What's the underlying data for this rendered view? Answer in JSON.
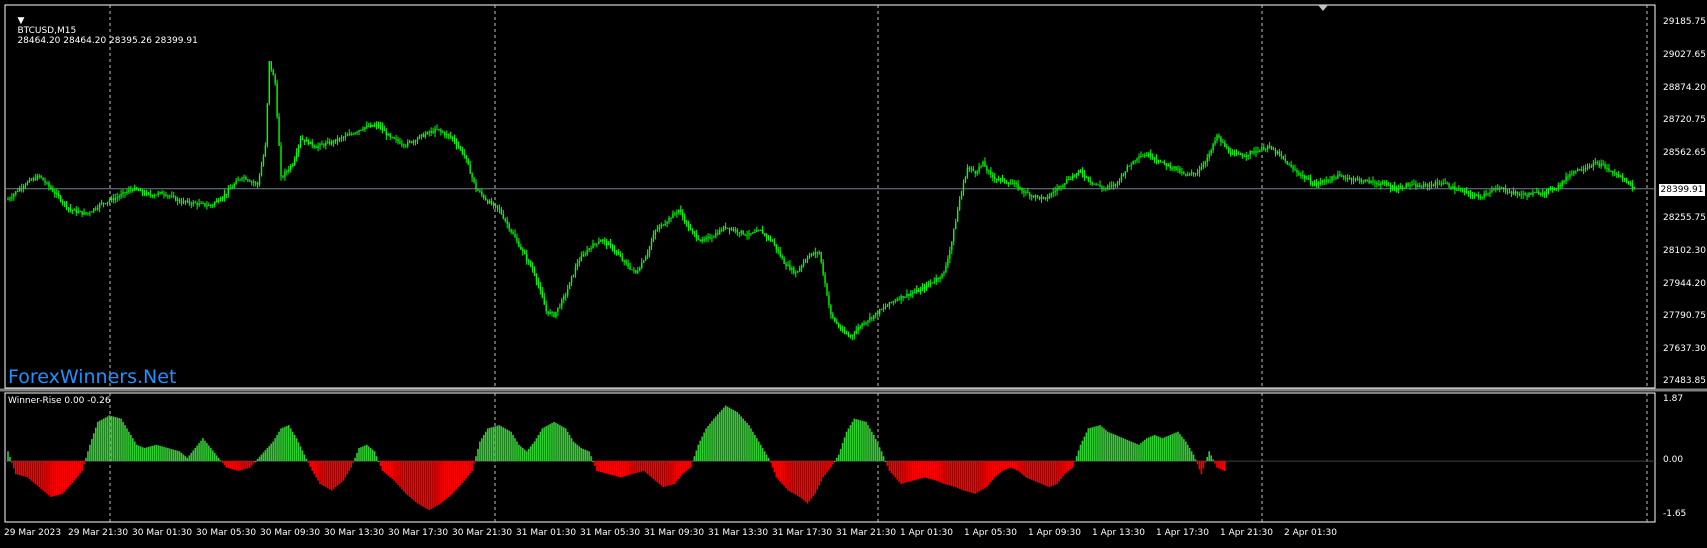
{
  "chart_header": {
    "collapse_icon": "triangle-down-icon",
    "symbol_timeframe": "BTCUSD,M15",
    "ohlc": "28464.20 28464.20 28395.26 28399.91"
  },
  "indicator_header": "Winner-Rise 0.00 -0.26",
  "watermark": "ForexWinners.Net",
  "current_price_label": "28399.91",
  "price_ticks": [
    "29185.75",
    "29027.65",
    "28874.20",
    "28720.75",
    "28562.65",
    "28255.75",
    "28102.30",
    "27944.20",
    "27790.75",
    "27637.30",
    "27483.85"
  ],
  "indicator_ticks": [
    "1.87",
    "0.00",
    "-1.65"
  ],
  "time_ticks": [
    "29 Mar 2023",
    "29 Mar 21:30",
    "30 Mar 01:30",
    "30 Mar 05:30",
    "30 Mar 09:30",
    "30 Mar 13:30",
    "30 Mar 17:30",
    "30 Mar 21:30",
    "31 Mar 01:30",
    "31 Mar 05:30",
    "31 Mar 09:30",
    "31 Mar 13:30",
    "31 Mar 17:30",
    "31 Mar 21:30",
    "1 Apr 01:30",
    "1 Apr 05:30",
    "1 Apr 09:30",
    "1 Apr 13:30",
    "1 Apr 17:30",
    "1 Apr 21:30",
    "2 Apr 01:30"
  ],
  "colors": {
    "background": "#000000",
    "candle": "#00ff00",
    "hist_up": "#32cd32",
    "hist_down": "#ff0000",
    "grid": "#c0c0c0",
    "price_line": "#708090",
    "watermark": "#1e90ff"
  },
  "chart_data": [
    {
      "type": "candlestick",
      "title": "BTCUSD,M15",
      "ylim": [
        27483.85,
        29185.75
      ],
      "x_tick_labels": [
        "29 Mar 2023",
        "29 Mar 21:30",
        "30 Mar 01:30",
        "30 Mar 05:30",
        "30 Mar 09:30",
        "30 Mar 13:30",
        "30 Mar 17:30",
        "30 Mar 21:30",
        "31 Mar 01:30",
        "31 Mar 05:30",
        "31 Mar 09:30",
        "31 Mar 13:30",
        "31 Mar 17:30",
        "31 Mar 21:30",
        "1 Apr 01:30",
        "1 Apr 05:30",
        "1 Apr 09:30",
        "1 Apr 13:30",
        "1 Apr 17:30",
        "1 Apr 21:30",
        "2 Apr 01:30"
      ],
      "close_path": [
        [
          0,
          28350
        ],
        [
          8,
          28420
        ],
        [
          16,
          28460
        ],
        [
          24,
          28380
        ],
        [
          32,
          28300
        ],
        [
          40,
          28280
        ],
        [
          48,
          28330
        ],
        [
          56,
          28360
        ],
        [
          64,
          28400
        ],
        [
          72,
          28370
        ],
        [
          80,
          28380
        ],
        [
          88,
          28340
        ],
        [
          96,
          28330
        ],
        [
          104,
          28320
        ],
        [
          112,
          28380
        ],
        [
          120,
          28460
        ],
        [
          128,
          28420
        ],
        [
          132,
          28600
        ],
        [
          134,
          29000
        ],
        [
          137,
          28900
        ],
        [
          140,
          28450
        ],
        [
          146,
          28520
        ],
        [
          150,
          28640
        ],
        [
          158,
          28600
        ],
        [
          166,
          28620
        ],
        [
          174,
          28650
        ],
        [
          182,
          28690
        ],
        [
          190,
          28700
        ],
        [
          196,
          28640
        ],
        [
          204,
          28610
        ],
        [
          212,
          28650
        ],
        [
          220,
          28680
        ],
        [
          228,
          28640
        ],
        [
          234,
          28560
        ],
        [
          240,
          28400
        ],
        [
          246,
          28340
        ],
        [
          252,
          28300
        ],
        [
          258,
          28200
        ],
        [
          264,
          28100
        ],
        [
          270,
          28000
        ],
        [
          276,
          27820
        ],
        [
          280,
          27800
        ],
        [
          286,
          27900
        ],
        [
          292,
          28050
        ],
        [
          298,
          28120
        ],
        [
          304,
          28160
        ],
        [
          310,
          28120
        ],
        [
          316,
          28050
        ],
        [
          322,
          28000
        ],
        [
          328,
          28100
        ],
        [
          332,
          28200
        ],
        [
          338,
          28250
        ],
        [
          344,
          28300
        ],
        [
          350,
          28200
        ],
        [
          356,
          28150
        ],
        [
          362,
          28180
        ],
        [
          368,
          28220
        ],
        [
          374,
          28200
        ],
        [
          380,
          28180
        ],
        [
          386,
          28200
        ],
        [
          392,
          28150
        ],
        [
          398,
          28050
        ],
        [
          404,
          28000
        ],
        [
          410,
          28080
        ],
        [
          416,
          28100
        ],
        [
          422,
          27800
        ],
        [
          428,
          27720
        ],
        [
          432,
          27700
        ],
        [
          438,
          27760
        ],
        [
          444,
          27800
        ],
        [
          450,
          27840
        ],
        [
          456,
          27880
        ],
        [
          462,
          27900
        ],
        [
          468,
          27920
        ],
        [
          474,
          27960
        ],
        [
          480,
          28000
        ],
        [
          484,
          28150
        ],
        [
          488,
          28350
        ],
        [
          492,
          28500
        ],
        [
          496,
          28480
        ],
        [
          500,
          28520
        ],
        [
          504,
          28460
        ],
        [
          510,
          28440
        ],
        [
          516,
          28420
        ],
        [
          522,
          28380
        ],
        [
          528,
          28360
        ],
        [
          532,
          28350
        ],
        [
          538,
          28400
        ],
        [
          544,
          28450
        ],
        [
          550,
          28480
        ],
        [
          556,
          28430
        ],
        [
          562,
          28400
        ],
        [
          568,
          28420
        ],
        [
          574,
          28500
        ],
        [
          580,
          28560
        ],
        [
          586,
          28560
        ],
        [
          592,
          28520
        ],
        [
          598,
          28500
        ],
        [
          604,
          28460
        ],
        [
          610,
          28480
        ],
        [
          616,
          28560
        ],
        [
          620,
          28650
        ],
        [
          624,
          28600
        ],
        [
          628,
          28560
        ],
        [
          634,
          28560
        ],
        [
          640,
          28580
        ],
        [
          646,
          28600
        ],
        [
          652,
          28560
        ],
        [
          658,
          28500
        ],
        [
          664,
          28460
        ],
        [
          670,
          28420
        ],
        [
          676,
          28440
        ],
        [
          682,
          28460
        ],
        [
          688,
          28450
        ],
        [
          694,
          28440
        ],
        [
          700,
          28430
        ],
        [
          706,
          28420
        ],
        [
          712,
          28400
        ],
        [
          718,
          28420
        ],
        [
          724,
          28410
        ],
        [
          730,
          28420
        ],
        [
          736,
          28430
        ],
        [
          742,
          28400
        ],
        [
          748,
          28380
        ],
        [
          754,
          28360
        ],
        [
          760,
          28390
        ],
        [
          766,
          28400
        ],
        [
          772,
          28380
        ],
        [
          778,
          28370
        ],
        [
          784,
          28380
        ],
        [
          790,
          28390
        ],
        [
          796,
          28420
        ],
        [
          802,
          28480
        ],
        [
          808,
          28500
        ],
        [
          814,
          28520
        ],
        [
          818,
          28510
        ],
        [
          822,
          28480
        ],
        [
          826,
          28460
        ],
        [
          830,
          28440
        ],
        [
          834,
          28400
        ]
      ]
    },
    {
      "type": "bar",
      "title": "Winner-Rise",
      "ylim": [
        -1.65,
        1.87
      ],
      "x_range_bars": [
        0,
        835
      ],
      "bars": [
        [
          0,
          0.3
        ],
        [
          4,
          -0.4
        ],
        [
          10,
          -0.5
        ],
        [
          16,
          -0.8
        ],
        [
          22,
          -1.1
        ],
        [
          28,
          -1.0
        ],
        [
          34,
          -0.6
        ],
        [
          38,
          -0.3
        ],
        [
          42,
          0.5
        ],
        [
          46,
          1.2
        ],
        [
          52,
          1.4
        ],
        [
          58,
          1.3
        ],
        [
          62,
          0.9
        ],
        [
          66,
          0.5
        ],
        [
          70,
          0.4
        ],
        [
          76,
          0.5
        ],
        [
          82,
          0.4
        ],
        [
          88,
          0.3
        ],
        [
          92,
          0.1
        ],
        [
          96,
          0.4
        ],
        [
          100,
          0.7
        ],
        [
          104,
          0.4
        ],
        [
          108,
          0.1
        ],
        [
          112,
          -0.2
        ],
        [
          118,
          -0.3
        ],
        [
          124,
          -0.2
        ],
        [
          130,
          0.2
        ],
        [
          136,
          0.6
        ],
        [
          140,
          1.0
        ],
        [
          144,
          1.1
        ],
        [
          148,
          0.7
        ],
        [
          152,
          0.2
        ],
        [
          156,
          -0.3
        ],
        [
          160,
          -0.7
        ],
        [
          166,
          -0.9
        ],
        [
          172,
          -0.6
        ],
        [
          176,
          -0.2
        ],
        [
          180,
          0.4
        ],
        [
          184,
          0.5
        ],
        [
          188,
          0.3
        ],
        [
          192,
          -0.3
        ],
        [
          198,
          -0.6
        ],
        [
          204,
          -1.0
        ],
        [
          210,
          -1.3
        ],
        [
          216,
          -1.5
        ],
        [
          222,
          -1.3
        ],
        [
          228,
          -1.0
        ],
        [
          234,
          -0.6
        ],
        [
          238,
          -0.3
        ],
        [
          242,
          0.6
        ],
        [
          246,
          1.0
        ],
        [
          252,
          1.1
        ],
        [
          258,
          0.9
        ],
        [
          262,
          0.5
        ],
        [
          266,
          0.3
        ],
        [
          270,
          0.6
        ],
        [
          274,
          1.0
        ],
        [
          280,
          1.2
        ],
        [
          286,
          1.0
        ],
        [
          290,
          0.6
        ],
        [
          294,
          0.4
        ],
        [
          298,
          0.3
        ],
        [
          302,
          -0.3
        ],
        [
          308,
          -0.4
        ],
        [
          314,
          -0.5
        ],
        [
          320,
          -0.4
        ],
        [
          326,
          -0.3
        ],
        [
          330,
          -0.5
        ],
        [
          336,
          -0.8
        ],
        [
          342,
          -0.7
        ],
        [
          346,
          -0.4
        ],
        [
          350,
          -0.2
        ],
        [
          354,
          0.5
        ],
        [
          358,
          1.0
        ],
        [
          362,
          1.3
        ],
        [
          368,
          1.7
        ],
        [
          374,
          1.5
        ],
        [
          380,
          1.1
        ],
        [
          386,
          0.5
        ],
        [
          390,
          0.1
        ],
        [
          394,
          -0.5
        ],
        [
          400,
          -0.9
        ],
        [
          406,
          -1.1
        ],
        [
          410,
          -1.3
        ],
        [
          414,
          -1.0
        ],
        [
          418,
          -0.5
        ],
        [
          422,
          -0.2
        ],
        [
          426,
          0.2
        ],
        [
          430,
          0.9
        ],
        [
          434,
          1.3
        ],
        [
          440,
          1.2
        ],
        [
          444,
          0.8
        ],
        [
          448,
          0.3
        ],
        [
          452,
          -0.3
        ],
        [
          458,
          -0.7
        ],
        [
          464,
          -0.6
        ],
        [
          470,
          -0.5
        ],
        [
          476,
          -0.6
        ],
        [
          480,
          -0.7
        ],
        [
          486,
          -0.8
        ],
        [
          490,
          -0.9
        ],
        [
          496,
          -1.0
        ],
        [
          502,
          -0.8
        ],
        [
          506,
          -0.5
        ],
        [
          510,
          -0.3
        ],
        [
          514,
          -0.2
        ],
        [
          518,
          -0.3
        ],
        [
          522,
          -0.5
        ],
        [
          526,
          -0.6
        ],
        [
          530,
          -0.7
        ],
        [
          534,
          -0.8
        ],
        [
          538,
          -0.7
        ],
        [
          542,
          -0.4
        ],
        [
          546,
          -0.2
        ],
        [
          550,
          0.5
        ],
        [
          554,
          1.0
        ],
        [
          560,
          1.1
        ],
        [
          564,
          0.9
        ],
        [
          568,
          0.8
        ],
        [
          572,
          0.7
        ],
        [
          576,
          0.6
        ],
        [
          580,
          0.5
        ],
        [
          584,
          0.7
        ],
        [
          588,
          0.8
        ],
        [
          592,
          0.7
        ],
        [
          596,
          0.8
        ],
        [
          600,
          0.9
        ],
        [
          604,
          0.6
        ],
        [
          608,
          0.2
        ],
        [
          612,
          -0.4
        ],
        [
          616,
          0.3
        ],
        [
          620,
          -0.2
        ],
        [
          624,
          -0.3
        ]
      ]
    }
  ]
}
